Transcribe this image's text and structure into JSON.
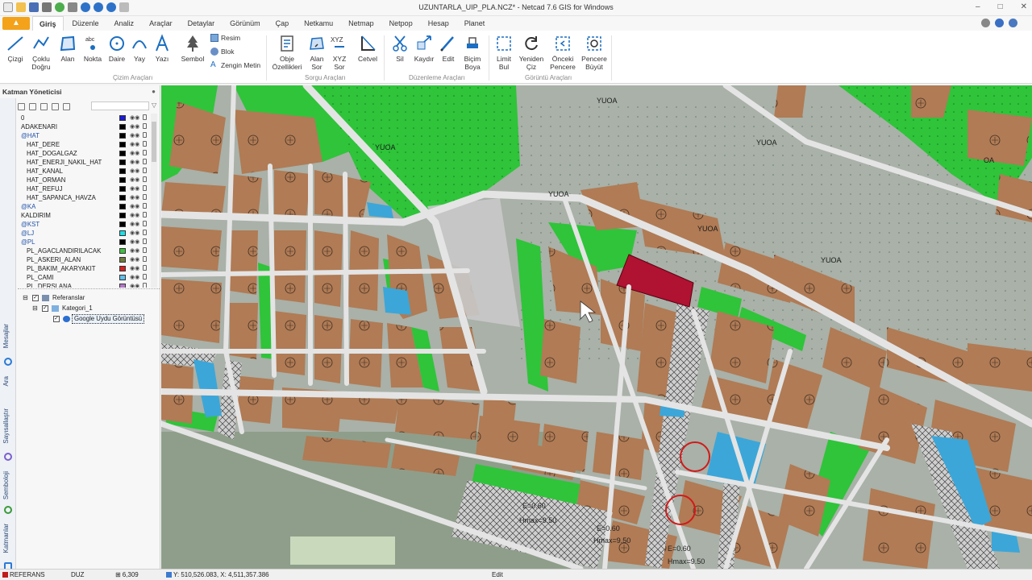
{
  "window": {
    "title": "UZUNTARLA_UIP_PLA.NCZ* - Netcad 7.6 GIS for Windows"
  },
  "menu": {
    "tabs": [
      "Giriş",
      "Düzenle",
      "Analiz",
      "Araçlar",
      "Detaylar",
      "Görünüm",
      "Çap",
      "Netkamu",
      "Netmap",
      "Netpop",
      "Hesap",
      "Planet"
    ],
    "active_tab": "Giriş"
  },
  "ribbon": {
    "draw_group": {
      "label": "Çizim Araçları",
      "buttons": [
        "Çizgi",
        "Çoklu Doğru",
        "Alan",
        "Nokta",
        "Daire",
        "Yay",
        "Yazı",
        "Sembol"
      ],
      "small": [
        "Resim",
        "Blok",
        "Zengin Metin"
      ]
    },
    "query_group": {
      "label": "Sorgu Araçları",
      "buttons": [
        "Obje Özellikleri",
        "Alan Sor",
        "XYZ Sor",
        "Cetvel"
      ]
    },
    "edit_group": {
      "label": "Düzenleme Araçları",
      "buttons": [
        "Sil",
        "Kaydır",
        "Edit",
        "Biçim Boya"
      ]
    },
    "view_group": {
      "label": "Görüntü Araçları",
      "buttons": [
        "Limit Bul",
        "Yeniden Çiz",
        "Önceki Pencere",
        "Pencere Büyüt"
      ]
    }
  },
  "layer_manager": {
    "title": "Katman Yöneticisi",
    "layers": [
      {
        "name": "0",
        "color": "#1a1ad8",
        "indent": false,
        "group": false
      },
      {
        "name": "ADAKENARI",
        "color": "#000000",
        "indent": false,
        "group": false
      },
      {
        "name": "@HAT",
        "color": "#000000",
        "indent": false,
        "group": true
      },
      {
        "name": "HAT_DERE",
        "color": "#000000",
        "indent": true,
        "group": false
      },
      {
        "name": "HAT_DOGALGAZ",
        "color": "#000000",
        "indent": true,
        "group": false
      },
      {
        "name": "HAT_ENERJI_NAKIL_HAT",
        "color": "#000000",
        "indent": true,
        "group": false
      },
      {
        "name": "HAT_KANAL",
        "color": "#000000",
        "indent": true,
        "group": false
      },
      {
        "name": "HAT_ORMAN",
        "color": "#000000",
        "indent": true,
        "group": false
      },
      {
        "name": "HAT_REFUJ",
        "color": "#000000",
        "indent": true,
        "group": false
      },
      {
        "name": "HAT_SAPANCA_HAVZA",
        "color": "#000000",
        "indent": true,
        "group": false
      },
      {
        "name": "@KA",
        "color": "#000000",
        "indent": false,
        "group": true
      },
      {
        "name": "KALDIRIM",
        "color": "#000000",
        "indent": false,
        "group": false
      },
      {
        "name": "@KST",
        "color": "#000000",
        "indent": false,
        "group": true
      },
      {
        "name": "@LJ",
        "color": "#19e0e8",
        "indent": false,
        "group": true
      },
      {
        "name": "@PL",
        "color": "#000000",
        "indent": false,
        "group": true
      },
      {
        "name": "PL_AGACLANDIRILACAK",
        "color": "#3cc13c",
        "indent": true,
        "group": false
      },
      {
        "name": "PL_ASKERI_ALAN",
        "color": "#6d7b3a",
        "indent": true,
        "group": false
      },
      {
        "name": "PL_BAKIM_AKARYAKIT",
        "color": "#d62020",
        "indent": true,
        "group": false
      },
      {
        "name": "PL_CAMI",
        "color": "#5fc0ea",
        "indent": true,
        "group": false
      },
      {
        "name": "PL_DERSLANA",
        "color": "#b478c8",
        "indent": true,
        "group": false
      }
    ],
    "tree": [
      {
        "label": "Referanslar",
        "level": 0
      },
      {
        "label": "Kategori_1",
        "level": 1
      },
      {
        "label": "Google Uydu Görüntüsü",
        "level": 2
      }
    ],
    "side_tabs": [
      "Mesajlar",
      "Ara",
      "Sayısallaştır",
      "Semboloji",
      "Katmanlar"
    ]
  },
  "map": {
    "labels": [
      "YUOA",
      "YUOA",
      "YUOA",
      "YUOA",
      "YUOA",
      "YUOA",
      "OA"
    ],
    "annotations": [
      "E=0.60",
      "Hmax=9.50",
      "E=0.60",
      "Hmax=9.50",
      "E=0.60",
      "Hmax=9.50"
    ]
  },
  "status": {
    "layer": "REFERANS",
    "mode": "DUZ",
    "scale": "6,309",
    "coords": "Y: 510,526.083, X: 4,511,357.386",
    "command": "Edit"
  },
  "colors": {
    "parcel": "#b07b55",
    "green": "#2fc43a",
    "road": "#dcdcdc",
    "water": "#3ca6d8",
    "highlight": "#b01232",
    "accent": "#f4a21a"
  }
}
